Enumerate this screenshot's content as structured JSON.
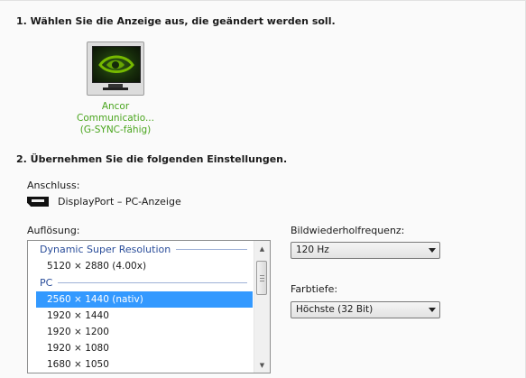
{
  "step1": {
    "heading": "1. Wählen Sie die Anzeige aus, die geändert werden soll."
  },
  "display": {
    "name": "Ancor Communicatio...",
    "subtitle": "(G-SYNC-fähig)"
  },
  "step2": {
    "heading": "2. Übernehmen Sie die folgenden Einstellungen."
  },
  "connection": {
    "label": "Anschluss:",
    "value": "DisplayPort – PC-Anzeige",
    "icon": "displayport-icon"
  },
  "resolution": {
    "label": "Auflösung:",
    "groups": [
      {
        "header": "Dynamic Super Resolution",
        "items": [
          {
            "text": "5120 × 2880 (4.00x)",
            "selected": false
          }
        ]
      },
      {
        "header": "PC",
        "items": [
          {
            "text": "2560 × 1440 (nativ)",
            "selected": true
          },
          {
            "text": "1920 × 1440",
            "selected": false
          },
          {
            "text": "1920 × 1200",
            "selected": false
          },
          {
            "text": "1920 × 1080",
            "selected": false
          },
          {
            "text": "1680 × 1050",
            "selected": false
          }
        ]
      }
    ]
  },
  "refresh_rate": {
    "label": "Bildwiederholfrequenz:",
    "value": "120 Hz"
  },
  "color_depth": {
    "label": "Farbtiefe:",
    "value": "Höchste (32 Bit)"
  },
  "colors": {
    "accent_green": "#4aa51e",
    "selection_blue": "#3399ff",
    "group_header": "#2a4d9a"
  }
}
